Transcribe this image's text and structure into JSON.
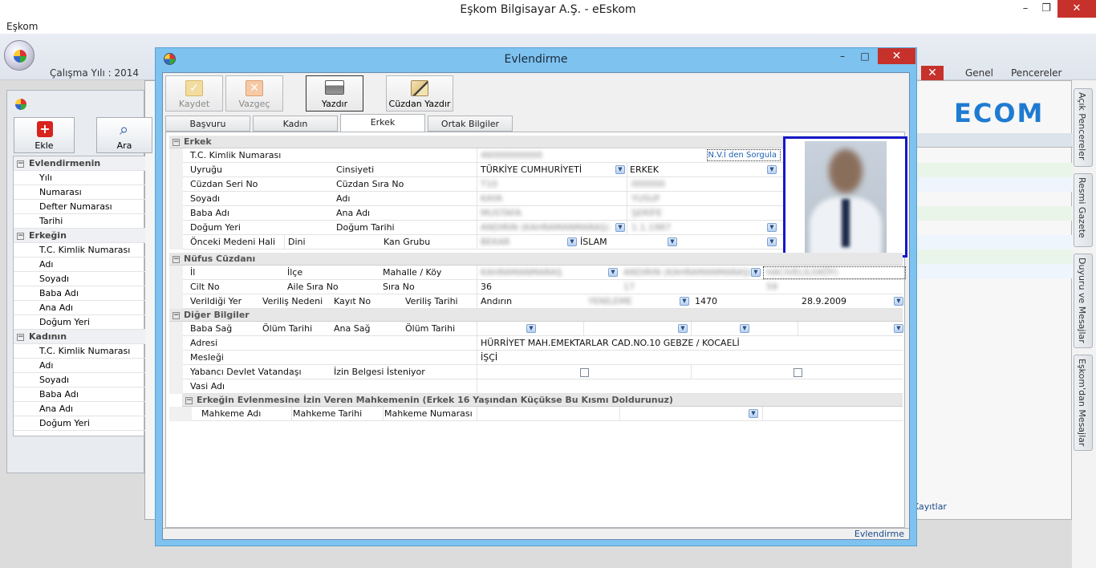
{
  "app": {
    "title": "Eşkom Bilgisayar A.Ş. - eEskom",
    "menu": "Eşkom",
    "calisma_yili": "Çalışma Yılı : 2014",
    "ribbon_tabs": [
      "Genel",
      "Pencereler"
    ],
    "brand_text": "ECOM",
    "kayitlar": "Kayıtlar",
    "side_tabs": [
      "Açık Pencereler",
      "Resmi Gazete",
      "Duyuru ve Mesajlar",
      "Eşkom'dan Mesajlar"
    ],
    "window_buttons": {
      "minimize": "–",
      "restore": "❐",
      "close": "✕"
    }
  },
  "bg_form": {
    "buttons": [
      "Ekle",
      "Ara"
    ],
    "groups": [
      {
        "title": "Evlendirmenin",
        "items": [
          "Yılı",
          "Numarası",
          "Defter Numarası",
          "Tarihi"
        ]
      },
      {
        "title": "Erkeğin",
        "items": [
          "T.C. Kimlik Numarası",
          "Adı",
          "Soyadı",
          "Baba Adı",
          "Ana Adı",
          "Doğum Yeri"
        ]
      },
      {
        "title": "Kadının",
        "items": [
          "T.C. Kimlik Numarası",
          "Adı",
          "Soyadı",
          "Baba Adı",
          "Ana Adı",
          "Doğum Yeri"
        ]
      }
    ]
  },
  "dialog": {
    "title": "Evlendirme",
    "toolbar": {
      "kaydet": "Kaydet",
      "vazgec": "Vazgeç",
      "yazdir": "Yazdır",
      "cuzdan_yazdir": "Cüzdan Yazdır"
    },
    "tabs": [
      "Başvuru",
      "Kadın",
      "Erkek",
      "Ortak Bilgiler"
    ],
    "status": "Evlendirme",
    "sections": {
      "erkek": "Erkek",
      "nufus": "Nüfus Cüzdanı",
      "diger": "Diğer Bilgiler",
      "mahkeme": "Erkeğin Evlenmesine İzin Veren Mahkemenin (Erkek 16 Yaşından Küçükse Bu Kısmı Doldurunuz)"
    },
    "erkek": {
      "tc_label": "T.C. Kimlik Numarası",
      "tc_value": "46000000000",
      "nvi_button": "N.V.İ den Sorgula",
      "uyrugu_label": "Uyruğu",
      "uyrugu_value": "TÜRKİYE CUMHURİYETİ",
      "cinsiyeti_label": "Cinsiyeti",
      "cinsiyeti_value": "ERKEK",
      "cuzdan_seri_label": "Cüzdan Seri No",
      "cuzdan_seri_value": "T10",
      "cuzdan_sira_label": "Cüzdan Sıra No",
      "cuzdan_sira_value": "000000",
      "soyadi_label": "Soyadı",
      "soyadi_value": "KAYA",
      "adi_label": "Adı",
      "adi_value": "YUSUF",
      "baba_adi_label": "Baba Adı",
      "baba_adi_value": "MUSTAFA",
      "ana_adi_label": "Ana Adı",
      "ana_adi_value": "ŞERİFE",
      "dogum_yeri_label": "Doğum Yeri",
      "dogum_yeri_value": "ANDIRIN (KAHRAMANMARAŞ)",
      "dogum_tarihi_label": "Doğum Tarihi",
      "dogum_tarihi_value": "1.1.1987",
      "onceki_medeni_label": "Önceki Medeni Hali",
      "onceki_medeni_value": "BEKAR",
      "dini_label": "Dini",
      "dini_value": "İSLAM",
      "kan_grubu_label": "Kan Grubu"
    },
    "nufus": {
      "il_label": "İl",
      "il_value": "KAHRAMANMARAŞ",
      "ilce_label": "İlçe",
      "ilce_value": "ANDIRIN (KAHRAMANMARAŞ)",
      "mahalle_label": "Mahalle / Köy",
      "mahalle_value": "HACIVELİLİ(KÖY)",
      "cilt_label": "Cilt No",
      "cilt_value": "36",
      "aile_sira_label": "Aile Sıra No",
      "aile_sira_value": "17",
      "sira_label": "Sıra No",
      "sira_value": "59",
      "verildigi_yer_label": "Verildiği Yer",
      "verildigi_yer_value": "Andırın",
      "verilis_nedeni_label": "Veriliş Nedeni",
      "verilis_nedeni_value": "YENİLEME",
      "kayit_no_label": "Kayıt No",
      "kayit_no_value": "1470",
      "verilis_tarihi_label": "Veriliş Tarihi",
      "verilis_tarihi_value": "28.9.2009"
    },
    "diger": {
      "baba_sag_label": "Baba Sağ",
      "olum_tarihi_label": "Ölüm Tarihi",
      "ana_sag_label": "Ana Sağ",
      "olum_tarihi2_label": "Ölüm Tarihi",
      "adresi_label": "Adresi",
      "adresi_value": "HÜRRİYET MAH.EMEKTARLAR CAD.NO.10 GEBZE / KOCAELİ",
      "meslegi_label": "Mesleği",
      "meslegi_value": "İŞÇİ",
      "yabanci_label": "Yabancı Devlet Vatandaşı",
      "izin_label": "İzin Belgesi İsteniyor",
      "vasi_label": "Vasi Adı"
    },
    "mahkeme": {
      "adi_label": "Mahkeme Adı",
      "tarihi_label": "Mahkeme Tarihi",
      "numarasi_label": "Mahkeme Numarası"
    }
  },
  "colors": {
    "dialog_frame": "#7ec2f0",
    "close_red": "#c7312b",
    "photo_border": "#1616c8",
    "link_blue": "#1a4a8a",
    "brand_blue": "#1f7bd1"
  }
}
